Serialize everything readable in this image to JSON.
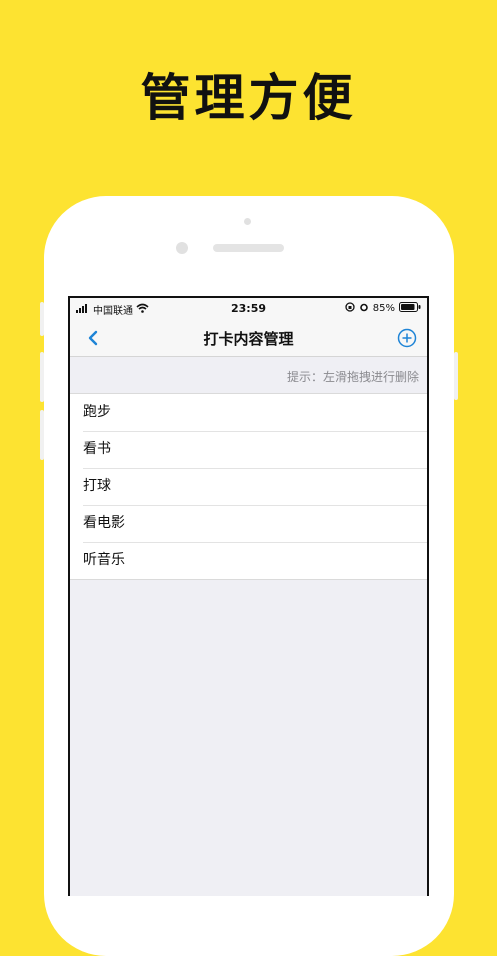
{
  "promo": {
    "headline": "管理方便"
  },
  "status_bar": {
    "carrier": "中国联通",
    "time": "23:59",
    "battery": "85%"
  },
  "nav": {
    "title": "打卡内容管理",
    "back_icon": "chevron-left-icon",
    "add_icon": "plus-circle-icon"
  },
  "hint": "提示：左滑拖拽进行删除",
  "items": [
    {
      "label": "跑步"
    },
    {
      "label": "看书"
    },
    {
      "label": "打球"
    },
    {
      "label": "看电影"
    },
    {
      "label": "听音乐"
    }
  ],
  "colors": {
    "background": "#FDE331",
    "accent": "#1E84D6"
  }
}
